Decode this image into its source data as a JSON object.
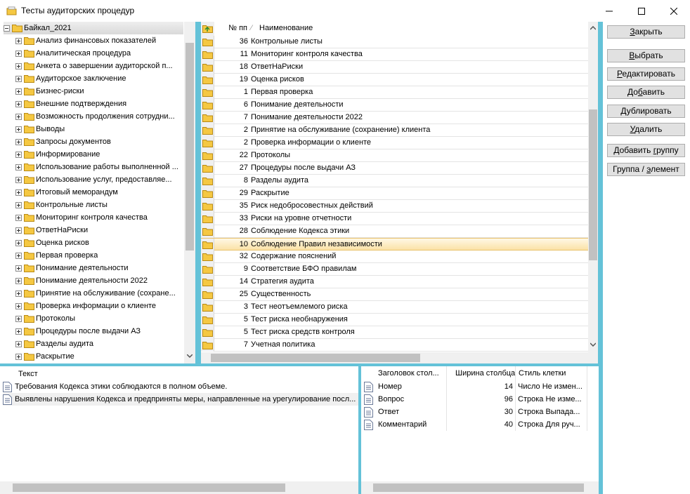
{
  "window": {
    "title": "Тесты аудиторских процедур"
  },
  "tree": {
    "root": "Байкал_2021",
    "items": [
      "Анализ финансовых показателей",
      "Аналитическая процедура",
      "Анкета о завершении аудиторской п...",
      "Аудиторское заключение",
      "Бизнес-риски",
      "Внешние подтверждения",
      "Возможность продолжения сотрудни...",
      "Выводы",
      "Запросы документов",
      "Информирование",
      "Использование работы выполненной ...",
      "Использование услуг, предоставляе...",
      "Итоговый меморандум",
      "Контрольные листы",
      "Мониторинг контроля качества",
      "ОтветНаРиски",
      "Оценка рисков",
      "Первая проверка",
      "Понимание деятельности",
      "Понимание деятельности 2022",
      "Принятие на обслуживание (сохране...",
      "Проверка информации о клиенте",
      "Протоколы",
      "Процедуры после выдачи АЗ",
      "Разделы аудита",
      "Раскрытие"
    ]
  },
  "list": {
    "col_num": "№ пп",
    "col_name": "Наименование",
    "selected_index": 16,
    "rows": [
      {
        "num": "36",
        "name": "Контрольные листы"
      },
      {
        "num": "11",
        "name": "Мониторинг контроля качества"
      },
      {
        "num": "18",
        "name": "ОтветНаРиски"
      },
      {
        "num": "19",
        "name": "Оценка рисков"
      },
      {
        "num": "1",
        "name": "Первая проверка"
      },
      {
        "num": "6",
        "name": "Понимание деятельности"
      },
      {
        "num": "7",
        "name": "Понимание деятельности 2022"
      },
      {
        "num": "2",
        "name": "Принятие на обслуживание (сохранение) клиента"
      },
      {
        "num": "2",
        "name": "Проверка информации о клиенте"
      },
      {
        "num": "22",
        "name": "Протоколы"
      },
      {
        "num": "27",
        "name": "Процедуры после выдачи АЗ"
      },
      {
        "num": "8",
        "name": "Разделы аудита"
      },
      {
        "num": "29",
        "name": "Раскрытие"
      },
      {
        "num": "35",
        "name": "Риск недобросовестных действий"
      },
      {
        "num": "33",
        "name": "Риски на уровне отчетности"
      },
      {
        "num": "28",
        "name": "Соблюдение Кодекса этики"
      },
      {
        "num": "10",
        "name": "Соблюдение Правил независимости"
      },
      {
        "num": "32",
        "name": "Содержание пояснений"
      },
      {
        "num": "9",
        "name": "Соответствие БФО правилам"
      },
      {
        "num": "14",
        "name": "Стратегия аудита"
      },
      {
        "num": "25",
        "name": "Существенность"
      },
      {
        "num": "3",
        "name": "Тест неотъемлемого риска"
      },
      {
        "num": "5",
        "name": "Тест риска необнаружения"
      },
      {
        "num": "5",
        "name": "Тест риска средств контроля"
      },
      {
        "num": "7",
        "name": "Учетная политика"
      }
    ]
  },
  "buttons": [
    {
      "pre": "",
      "u": "З",
      "post": "акрыть"
    },
    {
      "pre": "",
      "u": "В",
      "post": "ыбрать"
    },
    {
      "pre": "",
      "u": "Р",
      "post": "едактировать"
    },
    {
      "pre": "До",
      "u": "б",
      "post": "авить"
    },
    {
      "pre": "",
      "u": "Д",
      "post": "ублировать"
    },
    {
      "pre": "",
      "u": "У",
      "post": "далить"
    },
    {
      "pre": "Добавить ",
      "u": "г",
      "post": "руппу"
    },
    {
      "pre": "Группа / ",
      "u": "э",
      "post": "лемент"
    }
  ],
  "texts": {
    "header": "Текст",
    "rows": [
      "Требования Кодекса этики соблюдаются в полном объеме.",
      "Выявлены нарушения Кодекса и предприняты меры, направленные на урегулирование посл..."
    ]
  },
  "columns": {
    "headers": [
      "Заголовок стол...",
      "Ширина столбца",
      "Стиль клетки"
    ],
    "rows": [
      {
        "title": "Номер",
        "width": "14",
        "style": "Число Не измен..."
      },
      {
        "title": "Вопрос",
        "width": "96",
        "style": "Строка Не изме..."
      },
      {
        "title": "Ответ",
        "width": "30",
        "style": "Строка Выпада..."
      },
      {
        "title": "Комментарий",
        "width": "40",
        "style": "Строка Для руч..."
      }
    ]
  },
  "colors": {
    "frame": "#64c2d8",
    "selection": "#fbe2a7",
    "folder": "#f5c842"
  }
}
